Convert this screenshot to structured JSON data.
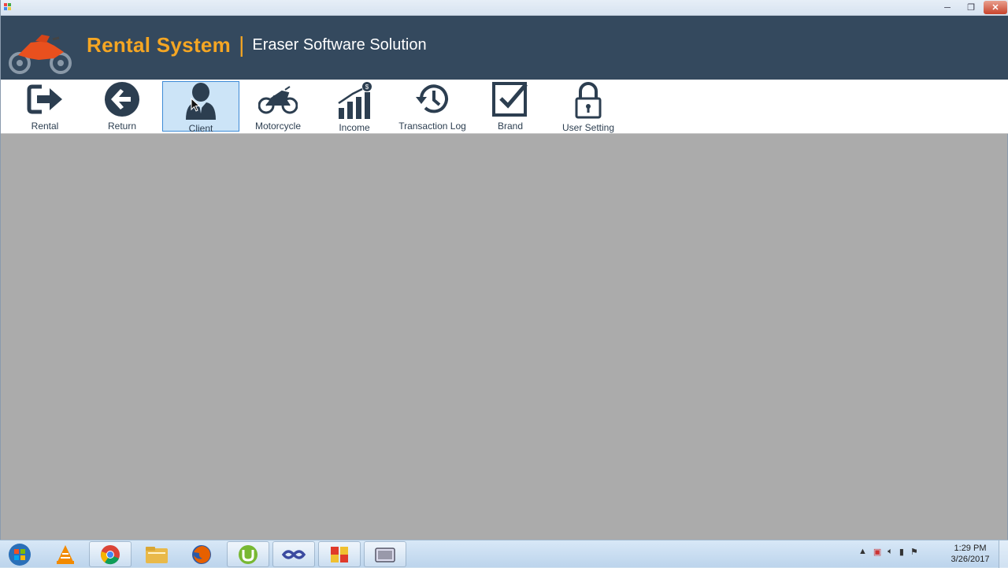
{
  "window": {
    "controls": {
      "minimize": "─",
      "maximize": "❐",
      "close": "✕"
    }
  },
  "header": {
    "app_name": "Rental System",
    "separator": "|",
    "company": "Eraser Software Solution",
    "logo_icon": "motorcycle-logo-icon",
    "accent_color": "#f5a623",
    "background_color": "#34495e"
  },
  "toolbar": {
    "items": [
      {
        "label": "Rental",
        "icon": "sign-out-arrow-icon",
        "active": false
      },
      {
        "label": "Return",
        "icon": "back-arrow-circle-icon",
        "active": false
      },
      {
        "label": "Client",
        "icon": "user-icon",
        "active": true
      },
      {
        "label": "Motorcycle",
        "icon": "motorcycle-icon",
        "active": false
      },
      {
        "label": "Income",
        "icon": "bar-chart-dollar-icon",
        "active": false
      },
      {
        "label": "Transaction Log",
        "icon": "history-clock-icon",
        "active": false
      },
      {
        "label": "Brand",
        "icon": "checkbox-icon",
        "active": false
      },
      {
        "label": "User Setting",
        "icon": "padlock-icon",
        "active": false
      }
    ]
  },
  "taskbar": {
    "apps": [
      {
        "icon": "vlc-icon"
      },
      {
        "icon": "chrome-icon"
      },
      {
        "icon": "file-explorer-icon"
      },
      {
        "icon": "firefox-icon"
      },
      {
        "icon": "utorrent-icon"
      },
      {
        "icon": "visual-studio-icon"
      },
      {
        "icon": "app-window-icon"
      },
      {
        "icon": "video-recorder-icon"
      }
    ],
    "clock": {
      "time": "1:29 PM",
      "date": "3/26/2017"
    }
  }
}
